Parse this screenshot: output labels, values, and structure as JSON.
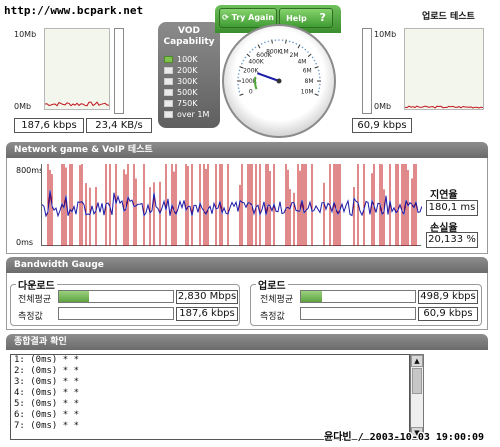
{
  "watermark_top": "http://www.bcpark.net",
  "watermark_bottom": "윤다빈 / 2003-10-03 19:00:09",
  "buttons": {
    "try_again": "Try Again",
    "help": "Help",
    "help_icon": "question-icon"
  },
  "download_chart": {
    "ymax": "10Mb",
    "ymin": "0Mb",
    "values": [
      "187,6 kbps",
      "23,4 KB/s"
    ]
  },
  "upload": {
    "title": "업로드 테스트",
    "ymax": "10Mb",
    "ymin": "0Mb",
    "value": "60,9 kbps"
  },
  "vod": {
    "title_line1": "VOD",
    "title_line2": "Capability",
    "levels": [
      "100K",
      "200K",
      "300K",
      "500K",
      "750K",
      "over 1M"
    ],
    "active_count": 1
  },
  "gauge": {
    "ticks": [
      "0",
      "100K",
      "200K",
      "400K",
      "600K",
      "800K",
      "1M",
      "2M",
      "4M",
      "6M",
      "8M",
      "10M"
    ],
    "needle_value": "187,6 kbps"
  },
  "network": {
    "section_title": "Network game & VoIP 테스트",
    "ymax": "800ms",
    "ymin": "0ms",
    "latency_label": "지연율",
    "latency_value": "180,1 ms",
    "loss_label": "손실율",
    "loss_value": "20,133 %"
  },
  "bandwidth": {
    "section_title": "Bandwidth Gauge",
    "download": {
      "title": "다운로드",
      "avg_label": "전체평균",
      "avg_value": "2,830 Mbps",
      "avg_fill": 0.26,
      "measured_label": "측정값",
      "measured_value": "187,6 kbps",
      "measured_fill": 0
    },
    "upload": {
      "title": "업로드",
      "avg_label": "전체평균",
      "avg_value": "498,9 kbps",
      "avg_fill": 0.18,
      "measured_label": "측정값",
      "measured_value": "60,9 kbps",
      "measured_fill": 0
    }
  },
  "summary": {
    "section_title": "종합결과 확인",
    "lines": [
      "1: (0ms) * *",
      "2: (0ms) * *",
      "3: (0ms) * *",
      "4: (0ms) * *",
      "5: (0ms) * *",
      "6: (0ms) * *",
      "7: (0ms) * *"
    ]
  },
  "colors": {
    "accent_green": "#4fa63a",
    "red_series": "#c0141a",
    "blue_series": "#1b1ba8",
    "bar_gray": "#6e6e6e"
  }
}
